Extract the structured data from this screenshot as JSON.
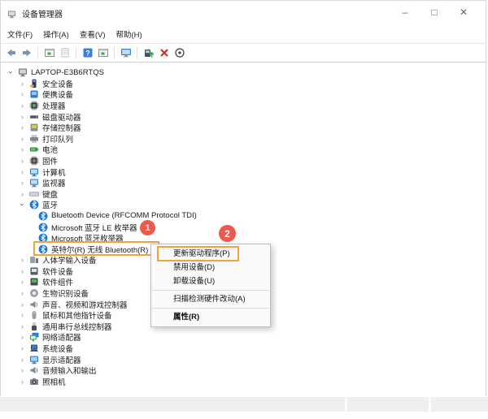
{
  "window": {
    "title": "设备管理器",
    "controls": [
      {
        "name": "minimize-button",
        "glyph": "–"
      },
      {
        "name": "maximize-button",
        "glyph": "□"
      },
      {
        "name": "close-button",
        "glyph": "✕"
      }
    ]
  },
  "menubar": {
    "items": [
      {
        "name": "menu-file",
        "label": "文件(F)"
      },
      {
        "name": "menu-action",
        "label": "操作(A)"
      },
      {
        "name": "menu-view",
        "label": "查看(V)"
      },
      {
        "name": "menu-help",
        "label": "帮助(H)"
      }
    ]
  },
  "toolbar": {
    "icons": [
      {
        "name": "back-icon",
        "type": "back"
      },
      {
        "name": "forward-icon",
        "type": "forward"
      },
      {
        "name": "separator",
        "type": "sep"
      },
      {
        "name": "console-window-icon",
        "type": "mmcwin"
      },
      {
        "name": "properties-page-icon",
        "type": "doc"
      },
      {
        "name": "separator",
        "type": "sep"
      },
      {
        "name": "help-icon",
        "type": "help"
      },
      {
        "name": "console-window-icon",
        "type": "mmcwin"
      },
      {
        "name": "separator",
        "type": "sep"
      },
      {
        "name": "computer-monitor-icon",
        "type": "montool"
      },
      {
        "name": "separator",
        "type": "sep"
      },
      {
        "name": "update-driver-icon",
        "type": "update"
      },
      {
        "name": "uninstall-device-icon",
        "type": "redx"
      },
      {
        "name": "scan-hardware-icon",
        "type": "scan"
      }
    ]
  },
  "tree": {
    "root": {
      "label": "LAPTOP-E3B6RTQS",
      "expanded": true,
      "icon": {
        "shape": "monitor",
        "c": "#6e7479",
        "a": "#cfd6da"
      }
    },
    "items": [
      {
        "label": "安全设备",
        "level": 1,
        "name": "tree-item-security-devices",
        "icon": {
          "shape": "tower",
          "c": "#2b3a6b",
          "a": "#f2a33a"
        }
      },
      {
        "label": "便携设备",
        "level": 1,
        "name": "tree-item-portable-devices",
        "icon": {
          "shape": "square",
          "c": "#2e7bd6",
          "a": "#9fc6ee"
        }
      },
      {
        "label": "处理器",
        "level": 1,
        "name": "tree-item-processors",
        "icon": {
          "shape": "chip",
          "c": "#3a4045",
          "a": "#57b25a"
        }
      },
      {
        "label": "磁盘驱动器",
        "level": 1,
        "name": "tree-item-disk-drives",
        "icon": {
          "shape": "bar",
          "c": "#51565b",
          "a": "#9aa0a5"
        }
      },
      {
        "label": "存储控制器",
        "level": 1,
        "name": "tree-item-storage-controllers",
        "icon": {
          "shape": "square",
          "c": "#8a9096",
          "a": "#d7c94f"
        }
      },
      {
        "label": "打印队列",
        "level": 1,
        "name": "tree-item-print-queues",
        "icon": {
          "shape": "printer",
          "c": "#80868c",
          "a": "#c8cdd1"
        }
      },
      {
        "label": "电池",
        "level": 1,
        "name": "tree-item-batteries",
        "icon": {
          "shape": "battery",
          "c": "#2f8f3a",
          "a": "#7fd08a"
        }
      },
      {
        "label": "固件",
        "level": 1,
        "name": "tree-item-firmware",
        "icon": {
          "shape": "chip",
          "c": "#4a4038",
          "a": "#8a7c6a"
        }
      },
      {
        "label": "计算机",
        "level": 1,
        "name": "tree-item-computer",
        "icon": {
          "shape": "monitor",
          "c": "#2e7bd6",
          "a": "#bfe0f7"
        }
      },
      {
        "label": "监视器",
        "level": 1,
        "name": "tree-item-monitors",
        "icon": {
          "shape": "monitor",
          "c": "#2e7bd6",
          "a": "#bfe0f7"
        }
      },
      {
        "label": "键盘",
        "level": 1,
        "name": "tree-item-keyboards",
        "icon": {
          "shape": "keyboard",
          "c": "#c3c8cd",
          "a": "#8a9096"
        }
      },
      {
        "label": "蓝牙",
        "level": 1,
        "expanded": true,
        "name": "tree-item-bluetooth",
        "icon": {
          "shape": "bluetooth",
          "c": "#1777d2",
          "a": "#ffffff"
        }
      },
      {
        "label": "Bluetooth Device (RFCOMM Protocol TDI)",
        "level": 2,
        "name": "tree-item-bluetooth-rfcomm",
        "icon": {
          "shape": "bluetooth",
          "c": "#1777d2",
          "a": "#ffffff"
        }
      },
      {
        "label": "Microsoft 蓝牙 LE 枚举器",
        "level": 2,
        "name": "tree-item-ms-bluetooth-le-enumerator",
        "icon": {
          "shape": "bluetooth",
          "c": "#1777d2",
          "a": "#ffffff"
        }
      },
      {
        "label": "Microsoft 蓝牙枚举器",
        "level": 2,
        "name": "tree-item-ms-bluetooth-enumerator",
        "icon": {
          "shape": "bluetooth",
          "c": "#1777d2",
          "a": "#ffffff"
        }
      },
      {
        "label": "英特尔(R) 无线 Bluetooth(R)",
        "level": 2,
        "highlighted": true,
        "name": "tree-item-intel-wireless-bluetooth",
        "icon": {
          "shape": "bluetooth",
          "c": "#1777d2",
          "a": "#ffffff"
        }
      },
      {
        "label": "人体学输入设备",
        "level": 1,
        "name": "tree-item-human-interface-devices",
        "icon": {
          "shape": "hid",
          "c": "#9aa0a6",
          "a": "#6e7479"
        }
      },
      {
        "label": "软件设备",
        "level": 1,
        "name": "tree-item-software-devices",
        "icon": {
          "shape": "square",
          "c": "#565c62",
          "a": "#e2e5e8"
        }
      },
      {
        "label": "软件组件",
        "level": 1,
        "name": "tree-item-software-components",
        "icon": {
          "shape": "square",
          "c": "#474d53",
          "a": "#57b25a"
        }
      },
      {
        "label": "生物识别设备",
        "level": 1,
        "name": "tree-item-biometric-devices",
        "icon": {
          "shape": "circle",
          "c": "#9aa0a6",
          "a": "#e8eaec"
        }
      },
      {
        "label": "声音、视频和游戏控制器",
        "level": 1,
        "name": "tree-item-sound-video-game-controllers",
        "icon": {
          "shape": "speaker",
          "c": "#80868c",
          "a": "#57b25a"
        }
      },
      {
        "label": "鼠标和其他指针设备",
        "level": 1,
        "name": "tree-item-mice-pointing-devices",
        "icon": {
          "shape": "mouse",
          "c": "#9aa0a6",
          "a": "#e2e5e8"
        }
      },
      {
        "label": "通用串行总线控制器",
        "level": 1,
        "name": "tree-item-usb-controllers",
        "icon": {
          "shape": "usb",
          "c": "#4a5056",
          "a": "#b9bec3"
        }
      },
      {
        "label": "网络适配器",
        "level": 1,
        "name": "tree-item-network-adapters",
        "icon": {
          "shape": "dmonitor",
          "c": "#2fa84f",
          "a": "#2e7bd6"
        }
      },
      {
        "label": "系统设备",
        "level": 1,
        "name": "tree-item-system-devices",
        "icon": {
          "shape": "laptop",
          "c": "#3a4045",
          "a": "#2e7bd6"
        }
      },
      {
        "label": "显示适配器",
        "level": 1,
        "name": "tree-item-display-adapters",
        "icon": {
          "shape": "monitor",
          "c": "#2e7bd6",
          "a": "#9fd4f2"
        }
      },
      {
        "label": "音频输入和输出",
        "level": 1,
        "name": "tree-item-audio-inputs-outputs",
        "icon": {
          "shape": "speaker",
          "c": "#80868c",
          "a": "#2e7bd6"
        }
      },
      {
        "label": "照相机",
        "level": 1,
        "name": "tree-item-cameras",
        "icon": {
          "shape": "camera",
          "c": "#7d838a",
          "a": "#3a4045"
        }
      }
    ]
  },
  "context_menu": {
    "items": [
      {
        "label": "更新驱动程序(P)",
        "name": "menu-item-update-driver",
        "highlighted": true
      },
      {
        "label": "禁用设备(D)",
        "name": "menu-item-disable-device"
      },
      {
        "label": "卸载设备(U)",
        "name": "menu-item-uninstall-device",
        "sep_after": true
      },
      {
        "label": "扫描检测硬件改动(A)",
        "name": "menu-item-scan-hardware-changes",
        "sep_after": true
      },
      {
        "label": "属性(R)",
        "name": "menu-item-properties",
        "bold": true
      }
    ]
  },
  "annotations": {
    "badges": [
      {
        "label": "1"
      },
      {
        "label": "2"
      }
    ],
    "highlight_color": "#F0A33C",
    "badge_color": "#EA5A4F"
  }
}
